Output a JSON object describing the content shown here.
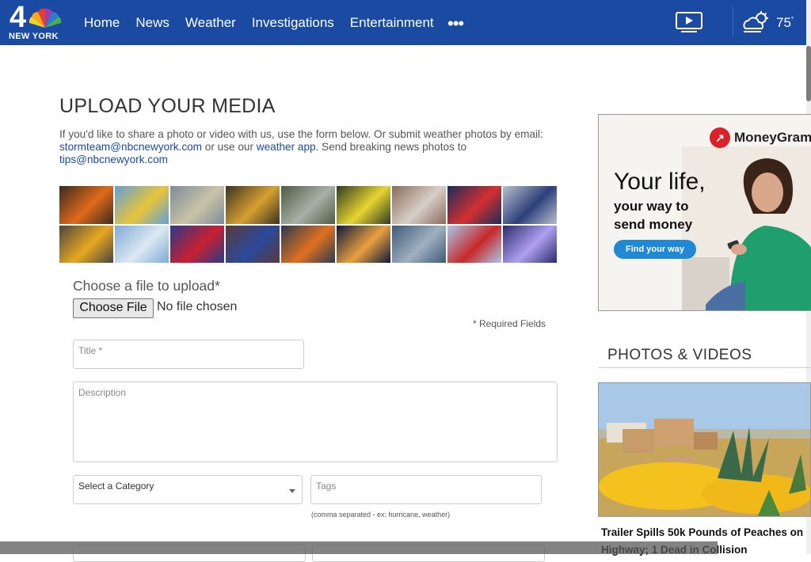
{
  "header": {
    "logo_number": "4",
    "logo_city": "NEW YORK",
    "nav": [
      "Home",
      "News",
      "Weather",
      "Investigations",
      "Entertainment"
    ],
    "more_label": "•••",
    "temperature": "75",
    "temperature_unit": "°"
  },
  "upload": {
    "title": "UPLOAD YOUR MEDIA",
    "intro_text_1": "If you'd like to share a photo or video with us, use the form below. Or submit weather photos by email: ",
    "email_storm": "stormteam@nbcnewyork.com",
    "intro_text_2": " or use our ",
    "weather_app_link": "weather app",
    "intro_text_3": ". Send breaking news photos to ",
    "email_tips": "tips@nbcnewyork.com",
    "choose_label": "Choose a file to upload*",
    "choose_button": "Choose File",
    "no_file": "No file chosen",
    "required_note": "*  Required Fields",
    "title_placeholder": "Title *",
    "description_placeholder": "Description",
    "category_selected": "Select a Category",
    "tags_placeholder": "Tags",
    "tags_hint": "(comma separated - ex: hurricane, weather)"
  },
  "ad": {
    "brand": "MoneyGram",
    "headline": "Your life,",
    "sub_line_1": "your way to",
    "sub_line_2": "send money",
    "cta": "Find your way"
  },
  "sidebar": {
    "section_title": "PHOTOS & VIDEOS",
    "caption": "Trailer Spills 50k Pounds of Peaches on Highway; 1 Dead in Collision"
  },
  "colors": {
    "header_bg": "#1b4aa3",
    "link": "#1b4aa3",
    "ad_cta": "#2089d6",
    "moneygram_red": "#d9222a"
  },
  "photo_strip": [
    {
      "name": "fire-smoke",
      "c1": "#3a2a20",
      "c2": "#e06a1a"
    },
    {
      "name": "balloons",
      "c1": "#5fa0d8",
      "c2": "#e8c43a"
    },
    {
      "name": "tornado",
      "c1": "#7d8d9a",
      "c2": "#c9c2a6"
    },
    {
      "name": "firefighters",
      "c1": "#3b3322",
      "c2": "#d6a030"
    },
    {
      "name": "flood-car",
      "c1": "#4e5b45",
      "c2": "#a7b0a6"
    },
    {
      "name": "crime-tape",
      "c1": "#2e3b22",
      "c2": "#e8d431"
    },
    {
      "name": "hail",
      "c1": "#8a6a5a",
      "c2": "#d8cfc8"
    },
    {
      "name": "gas-prices",
      "c1": "#1c2c5a",
      "c2": "#d33030"
    },
    {
      "name": "police-car",
      "c1": "#b8c0cc",
      "c2": "#2d3f7a"
    },
    {
      "name": "school-bus",
      "c1": "#4a4540",
      "c2": "#e6a820"
    },
    {
      "name": "helicopter",
      "c1": "#7eaad6",
      "c2": "#dde8f2"
    },
    {
      "name": "flag",
      "c1": "#2a3a8a",
      "c2": "#c82030"
    },
    {
      "name": "fans",
      "c1": "#5a3a3a",
      "c2": "#2a4a9a"
    },
    {
      "name": "truck-fire",
      "c1": "#2a3a50",
      "c2": "#e07020"
    },
    {
      "name": "bridge-night",
      "c1": "#0c1a3a",
      "c2": "#e8a040"
    },
    {
      "name": "storm-cloud",
      "c1": "#3e5a7a",
      "c2": "#a0b0c0"
    },
    {
      "name": "cyclone-coaster",
      "c1": "#a8c8e8",
      "c2": "#c82828"
    },
    {
      "name": "lightning",
      "c1": "#2a2a6a",
      "c2": "#b0a0f0"
    }
  ]
}
